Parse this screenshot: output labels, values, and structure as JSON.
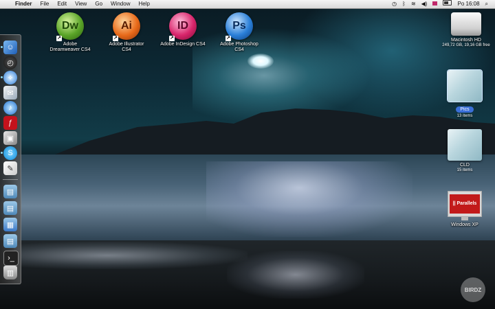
{
  "menubar": {
    "apple_icon": "apple-icon",
    "app_name": "Finder",
    "menus": [
      "File",
      "Edit",
      "View",
      "Go",
      "Window",
      "Help"
    ],
    "status_icons": [
      "time-machine-icon",
      "bluetooth-icon",
      "wifi-icon",
      "volume-icon",
      "input-flag-icon",
      "battery-icon"
    ],
    "clock": "Po 16:08",
    "spotlight_icon": "spotlight-icon"
  },
  "desktop_apps": [
    {
      "abbr": "Dw",
      "line1": "Adobe",
      "line2": "Dreamweaver CS4",
      "color": "#5aa428"
    },
    {
      "abbr": "Ai",
      "line1": "Adobe Illustrator",
      "line2": "CS4",
      "color": "#e86a1a"
    },
    {
      "abbr": "ID",
      "line1": "Adobe InDesign CS4",
      "line2": "",
      "color": "#d8256b"
    },
    {
      "abbr": "Ps",
      "line1": "Adobe Photoshop",
      "line2": "CS4",
      "color": "#2a7fd8"
    }
  ],
  "right_icons": {
    "hd": {
      "name": "Macintosh HD",
      "info": "249,72 GB, 19,16 GB free"
    },
    "pics": {
      "name": "Pics",
      "info": "13 items"
    },
    "cld": {
      "name": "CLD",
      "info": "15 items"
    },
    "winxp": {
      "name": "Windows XP",
      "logo_text": "|| Parallels"
    }
  },
  "dock_items": [
    "finder-icon",
    "dashboard-icon",
    "safari-icon",
    "mail-icon",
    "itunes-icon",
    "flash-icon",
    "preview-icon",
    "skype-icon",
    "textedit-icon",
    "applications-folder-icon",
    "documents-folder-icon",
    "pictures-folder-icon",
    "downloads-folder-icon",
    "terminal-icon",
    "trash-icon"
  ],
  "watermark": "BIRDZ"
}
